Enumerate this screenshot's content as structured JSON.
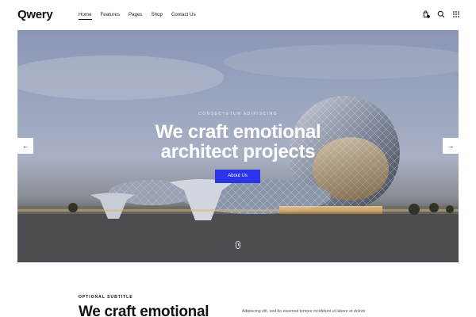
{
  "brand": {
    "logo": "Qwery"
  },
  "nav": [
    {
      "label": "Home",
      "active": true
    },
    {
      "label": "Features",
      "active": false
    },
    {
      "label": "Pages",
      "active": false
    },
    {
      "label": "Shop",
      "active": false
    },
    {
      "label": "Contact Us",
      "active": false
    }
  ],
  "header_icons": [
    "cart-icon",
    "search-icon",
    "grid-menu-icon"
  ],
  "cart_count": "0",
  "hero": {
    "eyebrow": "Consectetur adipiscing",
    "title_line1": "We craft emotional",
    "title_line2": "architect projects",
    "button_label": "About Us",
    "prev_arrow": "←",
    "next_arrow": "→"
  },
  "section": {
    "subtitle": "Optional subtitle",
    "title": "We craft emotional",
    "text": "Adipiscing elit, sed do eiusmod tempor incididunt ut labore et dolore"
  },
  "colors": {
    "accent": "#2b34e8",
    "text": "#141414",
    "background": "#ffffff"
  }
}
